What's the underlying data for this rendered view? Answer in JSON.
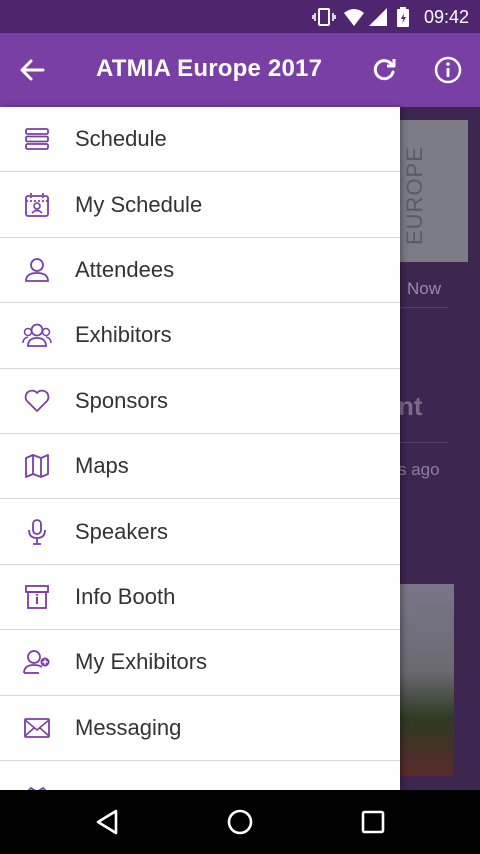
{
  "status_bar": {
    "time": "09:42",
    "icons": [
      "vibrate-icon",
      "wifi-icon",
      "signal-icon",
      "battery-icon"
    ]
  },
  "app_bar": {
    "title": "ATMIA Europe 2017",
    "back_icon": "arrow-left-icon",
    "refresh_icon": "refresh-icon",
    "info_icon": "info-icon"
  },
  "drawer": {
    "items": [
      {
        "label": "Schedule",
        "icon": "schedule-list-icon"
      },
      {
        "label": "My Schedule",
        "icon": "calendar-person-icon"
      },
      {
        "label": "Attendees",
        "icon": "person-icon"
      },
      {
        "label": "Exhibitors",
        "icon": "people-group-icon"
      },
      {
        "label": "Sponsors",
        "icon": "heart-icon"
      },
      {
        "label": "Maps",
        "icon": "map-icon"
      },
      {
        "label": "Speakers",
        "icon": "microphone-icon"
      },
      {
        "label": "Info Booth",
        "icon": "info-booth-icon"
      },
      {
        "label": "My Exhibitors",
        "icon": "person-star-icon"
      },
      {
        "label": "Messaging",
        "icon": "envelope-icon"
      }
    ]
  },
  "background": {
    "panel_text": "EUROPE",
    "now_text": "Now",
    "heading_fragment": "nt",
    "time_ago": "s ago"
  },
  "colors": {
    "status_bar": "#4f2570",
    "app_bar": "#7a3fa5",
    "icon_accent": "#7a3fa5"
  }
}
